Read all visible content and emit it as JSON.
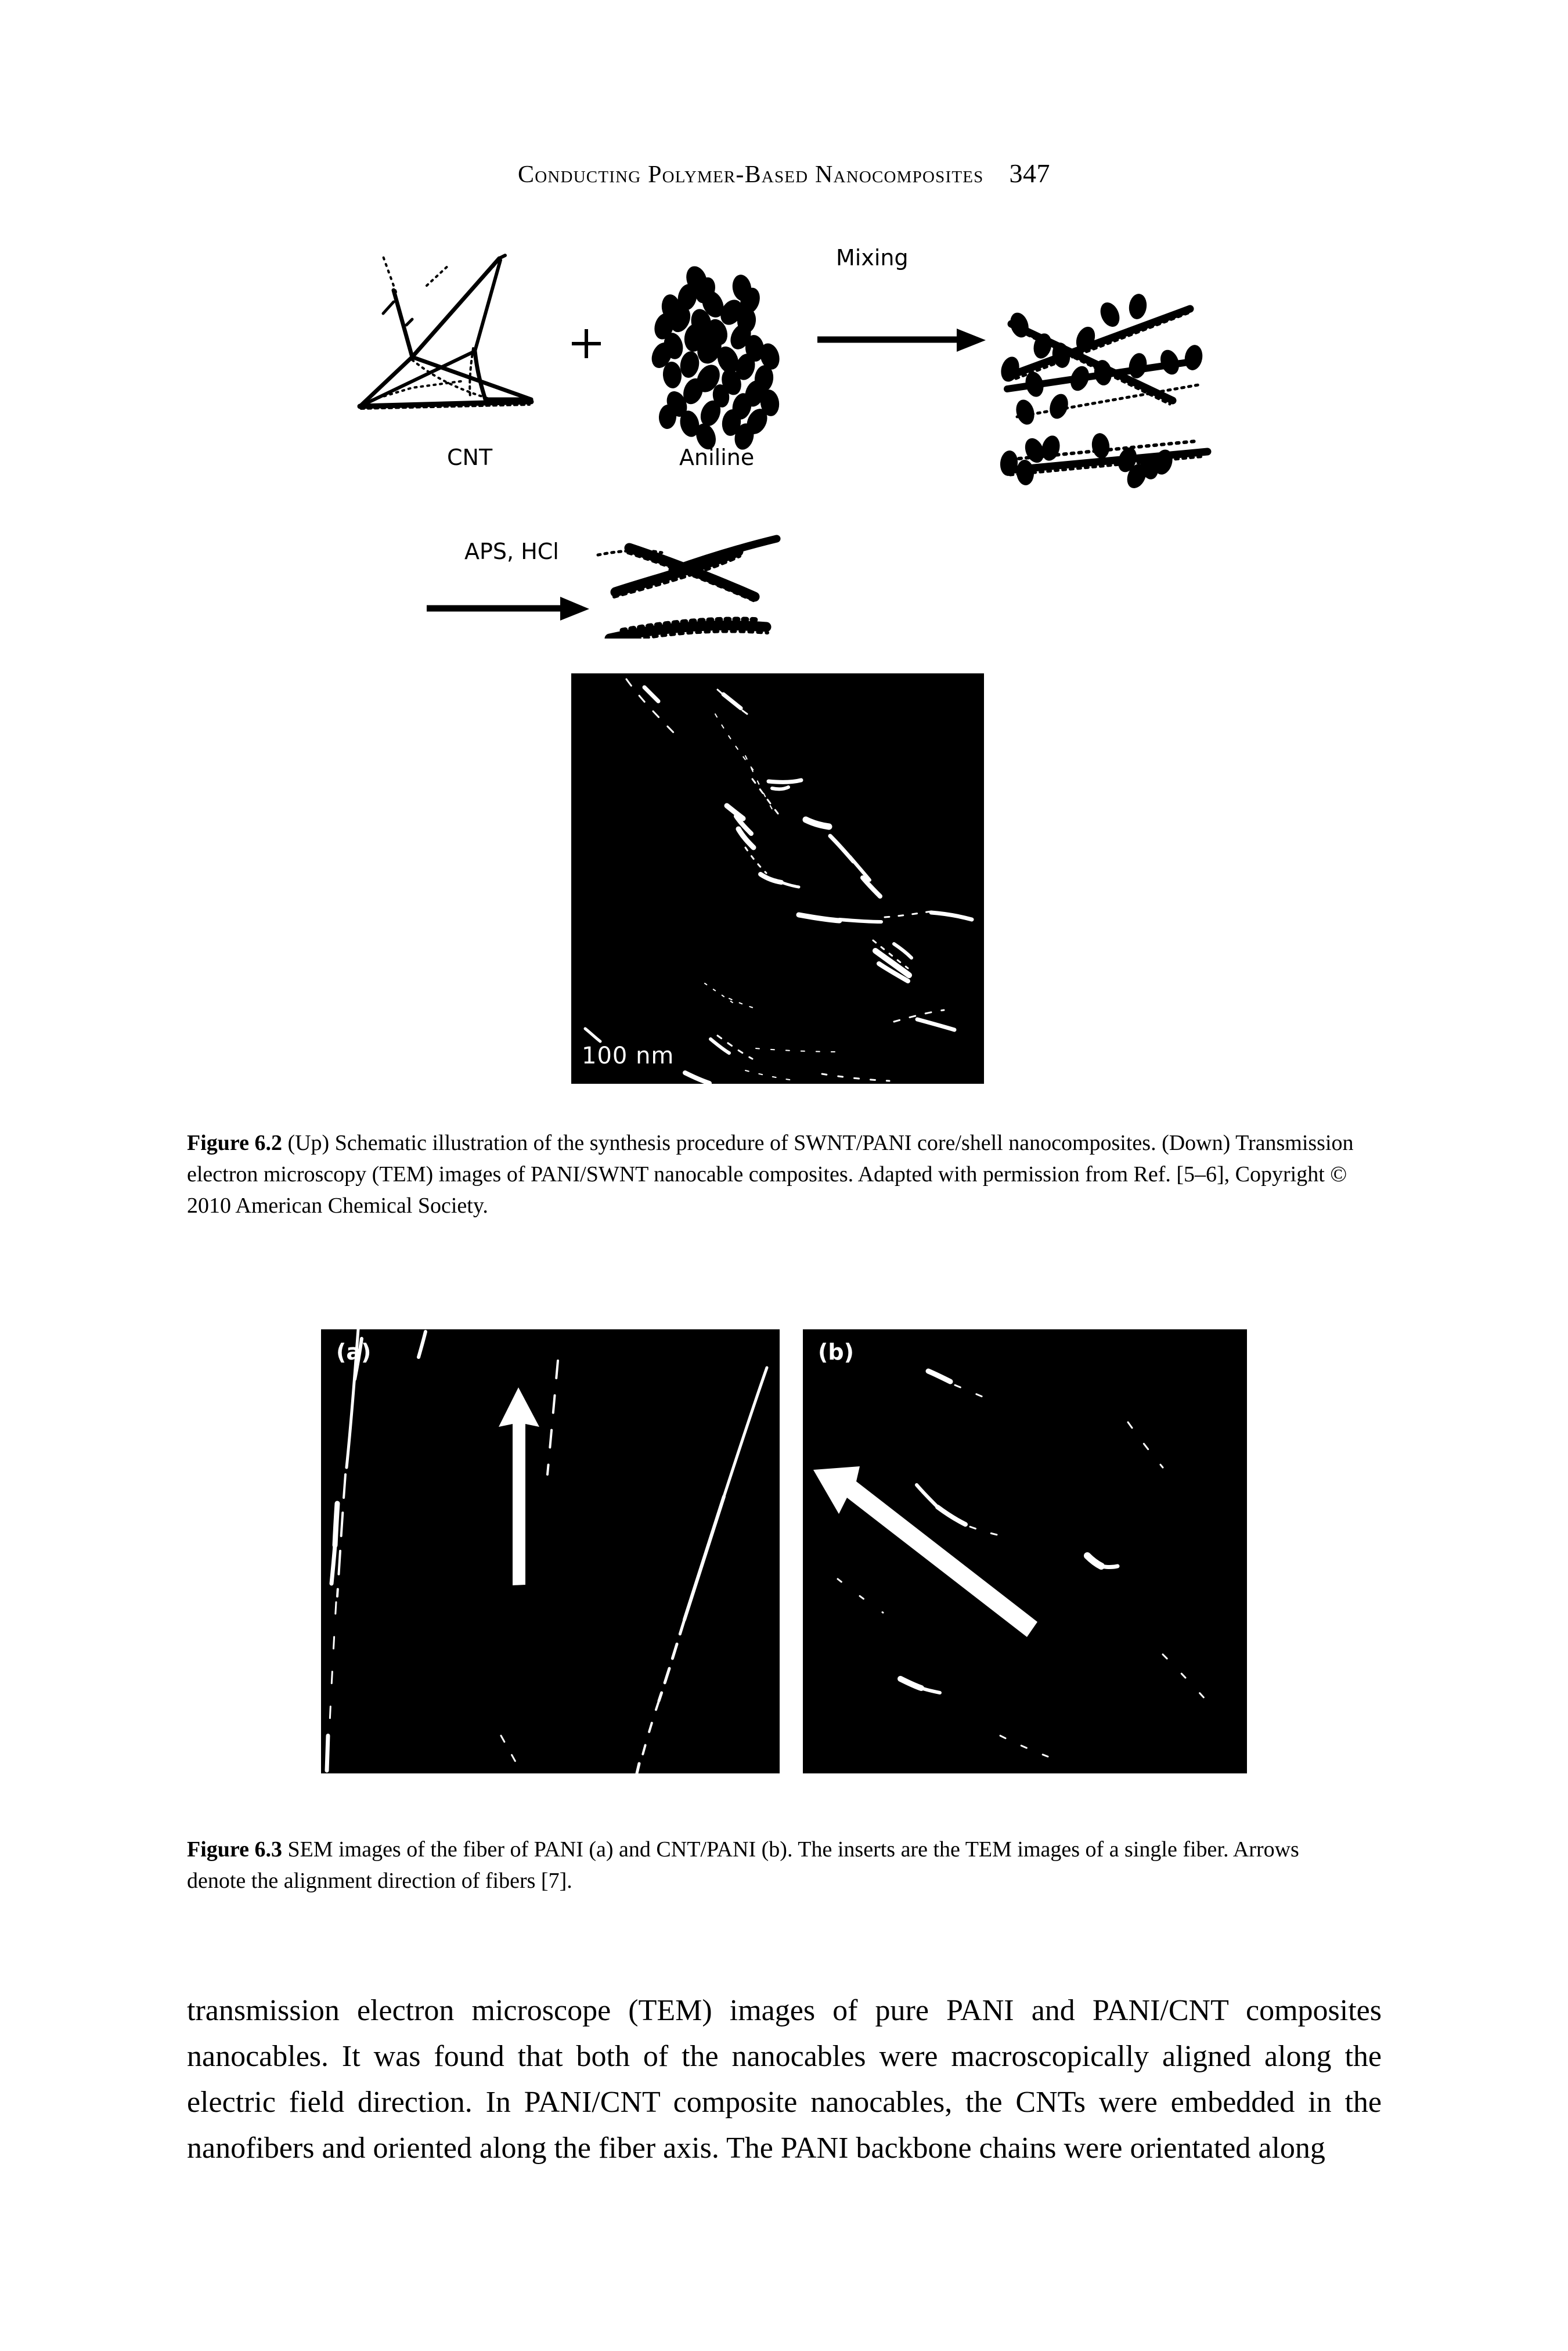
{
  "running_head": {
    "title": "Conducting Polymer-Based Nanocomposites",
    "page_number": "347"
  },
  "figure_6_2": {
    "schematic": {
      "labels": {
        "cnt": "CNT",
        "aniline": "Aniline",
        "plus": "+",
        "mixing": "Mixing",
        "aps_hcl": "APS, HCl"
      }
    },
    "tem_image": {
      "scale_bar": "100 nm"
    },
    "caption": {
      "label": "Figure 6.2",
      "text": "(Up) Schematic illustration of the synthesis procedure of SWNT/PANI core/shell nanocomposites. (Down) Transmission electron microscopy (TEM) images of PANI/SWNT nanocable composites. Adapted with permission from Ref. [5–6], Copyright © 2010 American Chemical Society."
    }
  },
  "figure_6_3": {
    "panels": [
      {
        "tag": "(a)",
        "subject": "PANI fiber"
      },
      {
        "tag": "(b)",
        "subject": "CNT/PANI fiber"
      }
    ],
    "caption": {
      "label": "Figure 6.3",
      "text": "SEM images of the fiber of PANI (a) and CNT/PANI (b). The inserts are the TEM images of a single fiber. Arrows denote the alignment direction of fibers [7]."
    }
  },
  "body": {
    "paragraph": "transmission electron microscope (TEM) images of pure PANI and PANI/CNT composites nanocables. It was found that both of the nanocables were macroscopically aligned along the electric field direction. In PANI/CNT composite nanocables, the CNTs were embedded in the nanofibers and ori­ented along the fiber axis. The PANI backbone chains were orientated along"
  },
  "colors": {
    "page_background": "#ffffff",
    "text": "#000000",
    "micrograph_background": "#000000",
    "micrograph_foreground": "#ffffff"
  }
}
